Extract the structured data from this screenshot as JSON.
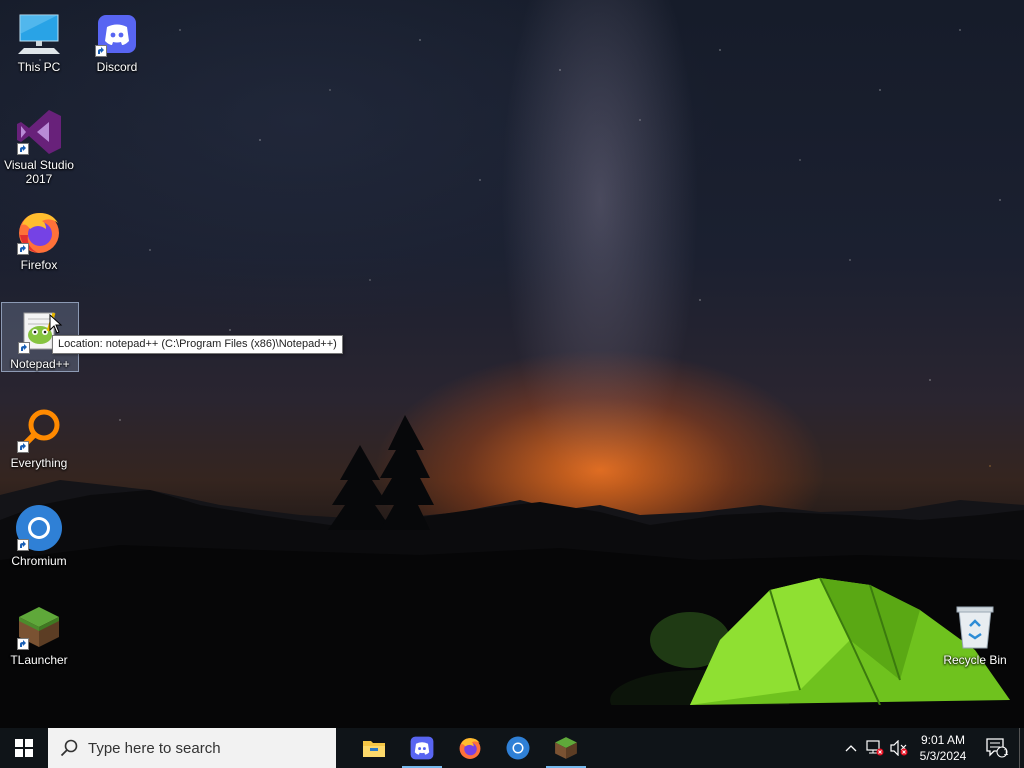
{
  "desktop": {
    "icons": [
      {
        "label": "This PC",
        "icon": "monitor-icon",
        "shortcut": false
      },
      {
        "label": "Discord",
        "icon": "discord-icon",
        "shortcut": true
      },
      {
        "label": "Visual Studio 2017",
        "icon": "visual-studio-icon",
        "shortcut": true
      },
      {
        "label": "Firefox",
        "icon": "firefox-icon",
        "shortcut": true
      },
      {
        "label": "Notepad++",
        "icon": "notepadpp-icon",
        "shortcut": true,
        "selected": true
      },
      {
        "label": "Everything",
        "icon": "everything-icon",
        "shortcut": true
      },
      {
        "label": "Chromium",
        "icon": "chromium-icon",
        "shortcut": true
      },
      {
        "label": "TLauncher",
        "icon": "tlauncher-icon",
        "shortcut": true
      },
      {
        "label": "Recycle Bin",
        "icon": "recycle-bin-icon",
        "shortcut": false
      }
    ],
    "tooltip": "Location: notepad++ (C:\\Program Files (x86)\\Notepad++)"
  },
  "taskbar": {
    "search_placeholder": "Type here to search",
    "pinned": [
      {
        "name": "File Explorer",
        "icon": "file-explorer-icon",
        "running": false
      },
      {
        "name": "Discord",
        "icon": "discord-icon",
        "running": true
      },
      {
        "name": "Firefox",
        "icon": "firefox-icon",
        "running": false
      },
      {
        "name": "Chromium",
        "icon": "chromium-icon",
        "running": false
      },
      {
        "name": "TLauncher",
        "icon": "tlauncher-icon",
        "running": true
      }
    ],
    "clock": {
      "time": "9:01 AM",
      "date": "5/3/2024"
    },
    "notification_count": "1"
  },
  "colors": {
    "taskbar_bg": "#0f1418",
    "search_bg": "#f2f2f2",
    "running_indicator": "#76b9ed",
    "tent_green": "#7ed321",
    "horizon_orange": "#ff7a1e"
  }
}
